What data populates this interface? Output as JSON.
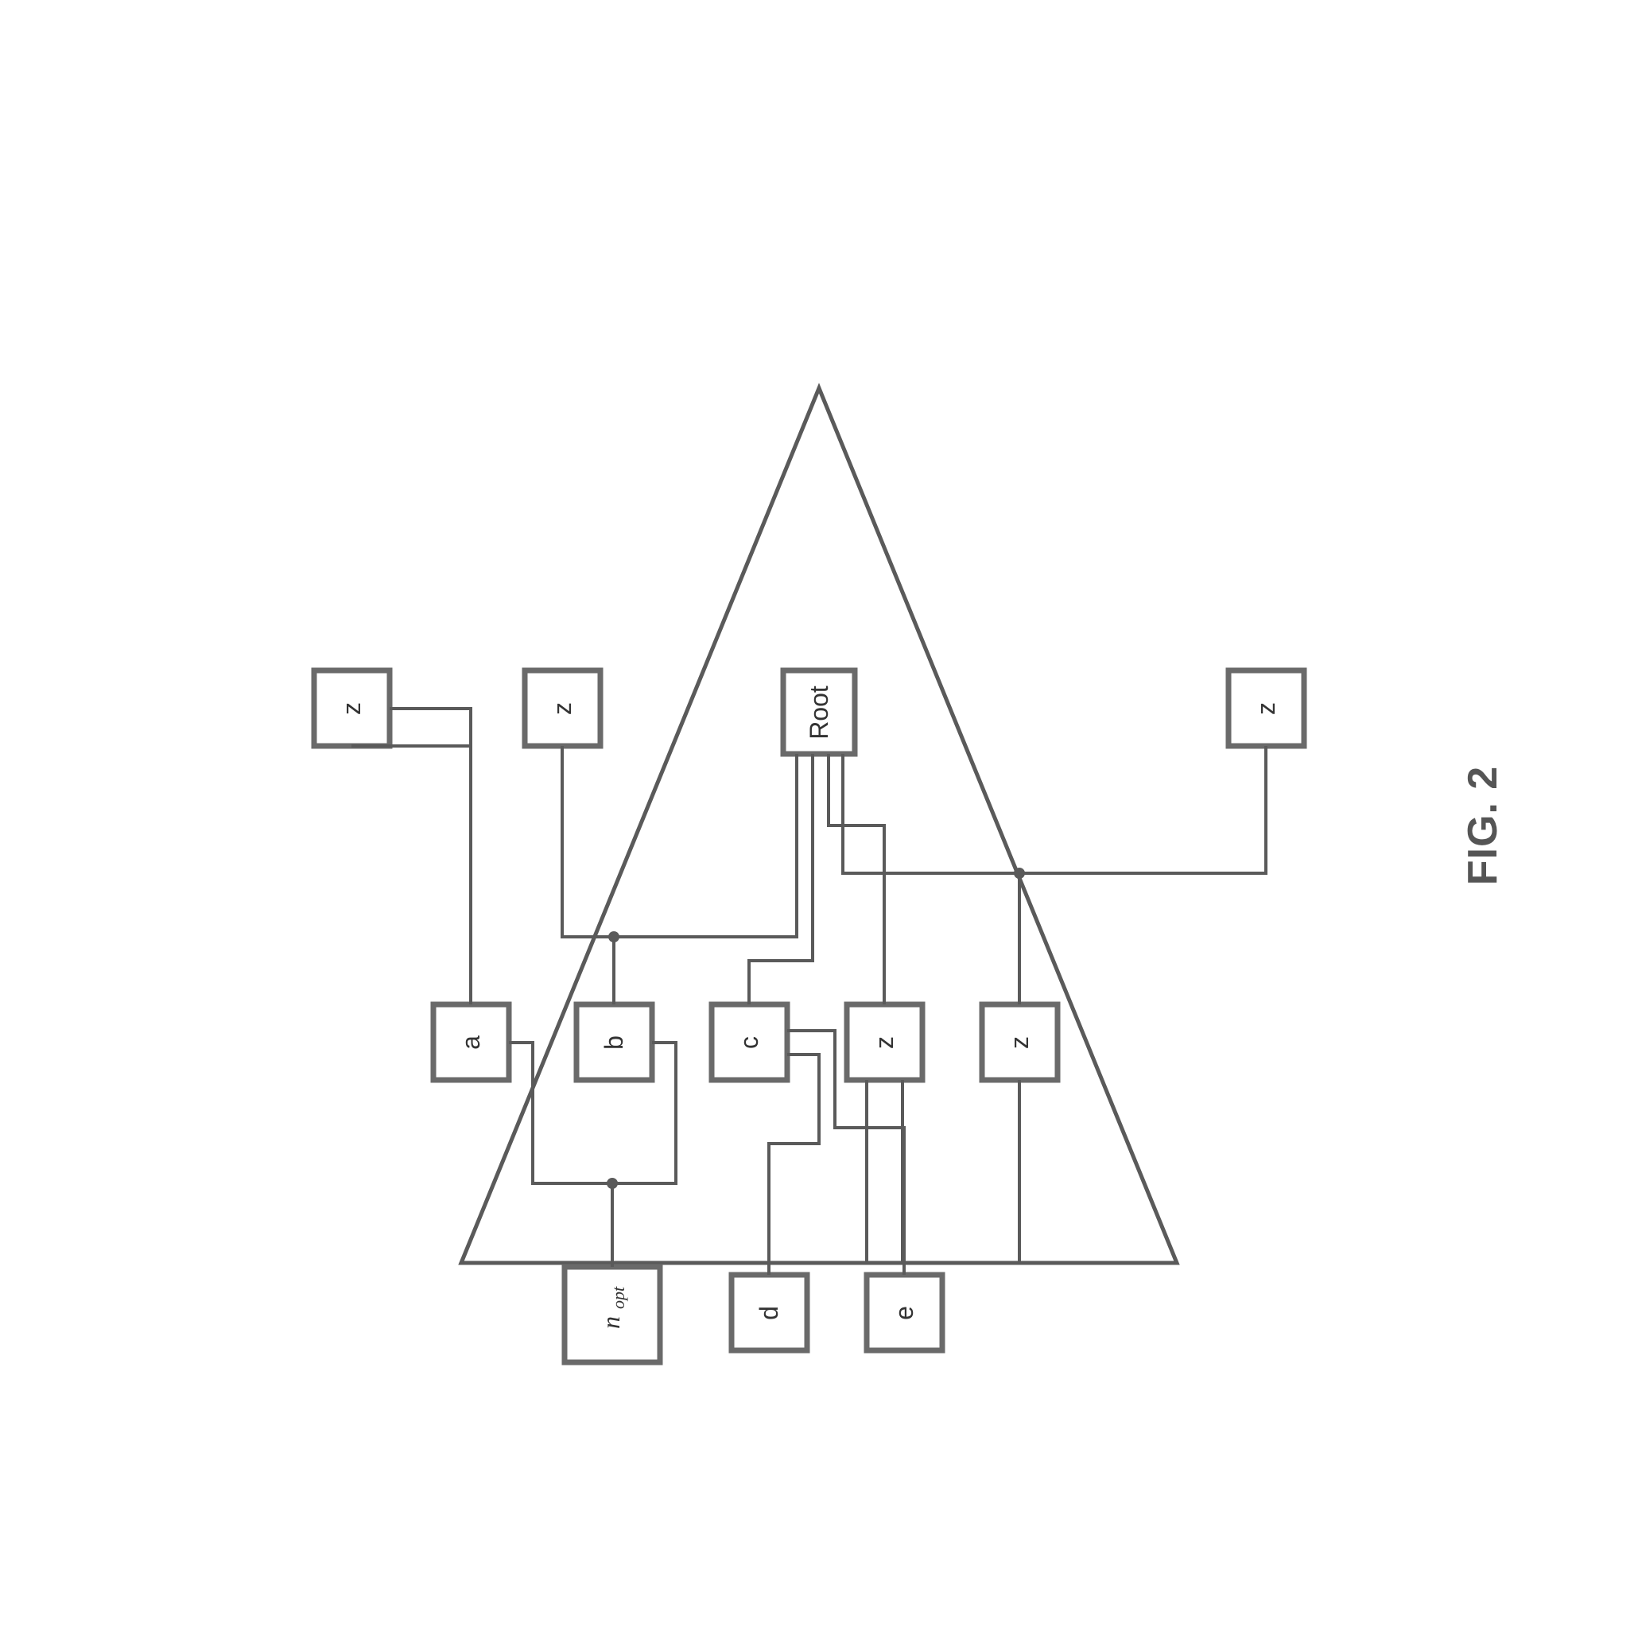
{
  "caption": "FIG. 2",
  "nodes": {
    "root": "Root",
    "a": "a",
    "b": "b",
    "c": "c",
    "d": "d",
    "e": "e",
    "z": "z",
    "nopt_main": "n",
    "nopt_sub": "opt"
  }
}
